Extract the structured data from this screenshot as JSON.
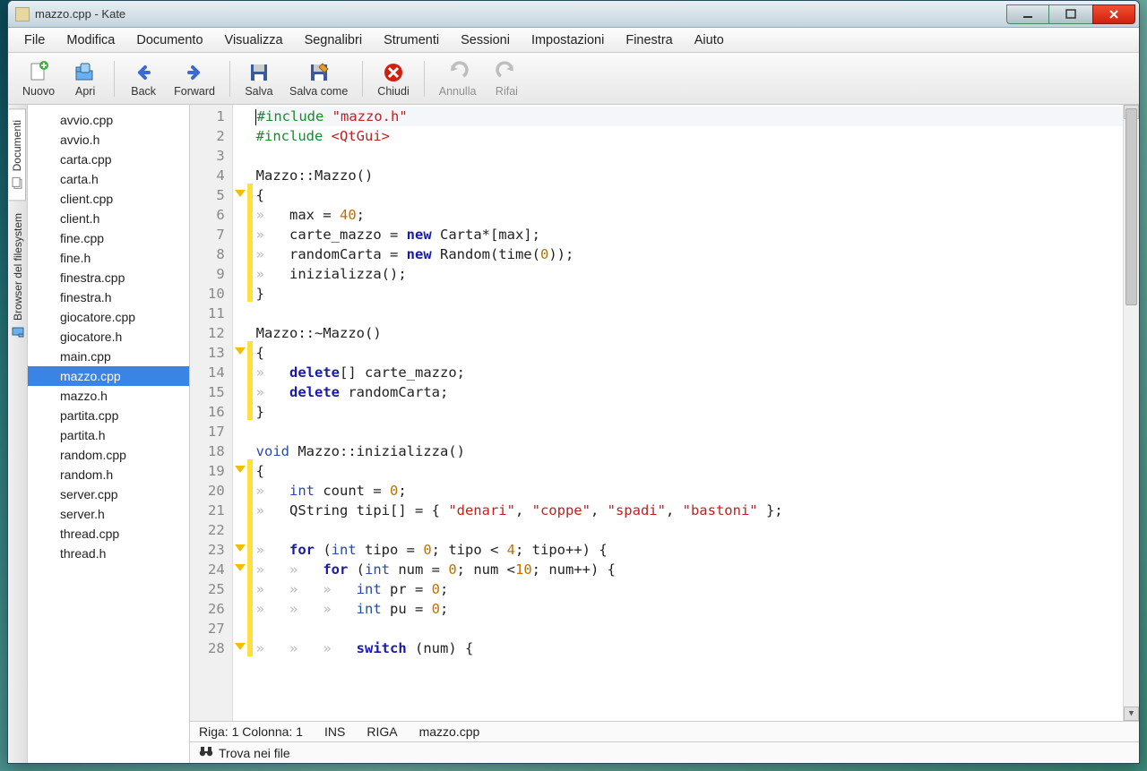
{
  "window": {
    "title": "mazzo.cpp - Kate"
  },
  "menu": [
    "File",
    "Modifica",
    "Documento",
    "Visualizza",
    "Segnalibri",
    "Strumenti",
    "Sessioni",
    "Impostazioni",
    "Finestra",
    "Aiuto"
  ],
  "toolbar": [
    {
      "icon": "new",
      "label": "Nuovo",
      "disabled": false
    },
    {
      "icon": "open",
      "label": "Apri",
      "disabled": false
    },
    {
      "sep": true
    },
    {
      "icon": "back",
      "label": "Back",
      "disabled": false
    },
    {
      "icon": "forward",
      "label": "Forward",
      "disabled": false
    },
    {
      "sep": true
    },
    {
      "icon": "save",
      "label": "Salva",
      "disabled": false
    },
    {
      "icon": "saveas",
      "label": "Salva come",
      "disabled": false
    },
    {
      "sep": true
    },
    {
      "icon": "close",
      "label": "Chiudi",
      "disabled": false
    },
    {
      "sep": true
    },
    {
      "icon": "undo",
      "label": "Annulla",
      "disabled": true
    },
    {
      "icon": "redo",
      "label": "Rifai",
      "disabled": true
    }
  ],
  "left_tabs": {
    "documents": "Documenti",
    "filesystem": "Browser del filesystem"
  },
  "files": [
    "avvio.cpp",
    "avvio.h",
    "carta.cpp",
    "carta.h",
    "client.cpp",
    "client.h",
    "fine.cpp",
    "fine.h",
    "finestra.cpp",
    "finestra.h",
    "giocatore.cpp",
    "giocatore.h",
    "main.cpp",
    "mazzo.cpp",
    "mazzo.h",
    "partita.cpp",
    "partita.h",
    "random.cpp",
    "random.h",
    "server.cpp",
    "server.h",
    "thread.cpp",
    "thread.h"
  ],
  "selected_file": "mazzo.cpp",
  "code_lines": [
    {
      "n": 1,
      "html": "<span class='pp'>#include</span> <span class='st'>\"mazzo.h\"</span>"
    },
    {
      "n": 2,
      "html": "<span class='pp'>#include</span> <span class='st'>&lt;QtGui&gt;</span>"
    },
    {
      "n": 3,
      "html": ""
    },
    {
      "n": 4,
      "html": "Mazzo::Mazzo()"
    },
    {
      "n": 5,
      "html": "{",
      "fold": true,
      "mod": true
    },
    {
      "n": 6,
      "html": "<span class='gy'>»   </span>max = <span class='nm'>40</span>;",
      "mod": true
    },
    {
      "n": 7,
      "html": "<span class='gy'>»   </span>carte_mazzo = <span class='kw'>new</span> Carta*[max];",
      "mod": true
    },
    {
      "n": 8,
      "html": "<span class='gy'>»   </span>randomCarta = <span class='kw'>new</span> Random(time(<span class='nm'>0</span>));",
      "mod": true
    },
    {
      "n": 9,
      "html": "<span class='gy'>»   </span>inizializza();",
      "mod": true
    },
    {
      "n": 10,
      "html": "}",
      "mod": true
    },
    {
      "n": 11,
      "html": ""
    },
    {
      "n": 12,
      "html": "Mazzo::~Mazzo()"
    },
    {
      "n": 13,
      "html": "{",
      "fold": true,
      "mod": true
    },
    {
      "n": 14,
      "html": "<span class='gy'>»   </span><span class='kw'>delete</span>[] carte_mazzo;",
      "mod": true
    },
    {
      "n": 15,
      "html": "<span class='gy'>»   </span><span class='kw'>delete</span> randomCarta;",
      "mod": true
    },
    {
      "n": 16,
      "html": "}",
      "mod": true
    },
    {
      "n": 17,
      "html": ""
    },
    {
      "n": 18,
      "html": "<span class='ty'>void</span> Mazzo::inizializza()"
    },
    {
      "n": 19,
      "html": "{",
      "fold": true,
      "mod": true
    },
    {
      "n": 20,
      "html": "<span class='gy'>»   </span><span class='ty'>int</span> count = <span class='nm'>0</span>;",
      "mod": true
    },
    {
      "n": 21,
      "html": "<span class='gy'>»   </span>QString tipi[] = { <span class='st'>\"denari\"</span>, <span class='st'>\"coppe\"</span>, <span class='st'>\"spadi\"</span>, <span class='st'>\"bastoni\"</span> };",
      "mod": true
    },
    {
      "n": 22,
      "html": "",
      "mod": true
    },
    {
      "n": 23,
      "html": "<span class='gy'>»   </span><span class='kw'>for</span> (<span class='ty'>int</span> tipo = <span class='nm'>0</span>; tipo &lt; <span class='nm'>4</span>; tipo++) {",
      "fold": true,
      "mod": true
    },
    {
      "n": 24,
      "html": "<span class='gy'>»   »   </span><span class='kw'>for</span> (<span class='ty'>int</span> num = <span class='nm'>0</span>; num &lt;<span class='nm'>10</span>; num++) {",
      "fold": true,
      "mod": true
    },
    {
      "n": 25,
      "html": "<span class='gy'>»   »   »   </span><span class='ty'>int</span> pr = <span class='nm'>0</span>;",
      "mod": true
    },
    {
      "n": 26,
      "html": "<span class='gy'>»   »   »   </span><span class='ty'>int</span> pu = <span class='nm'>0</span>;",
      "mod": true
    },
    {
      "n": 27,
      "html": "",
      "mod": true
    },
    {
      "n": 28,
      "html": "<span class='gy'>»   »   »   </span><span class='kw'>switch</span> (num) {",
      "fold": true,
      "mod": true
    }
  ],
  "status": {
    "riga_label": "Riga:",
    "riga": "1",
    "col_label": "Colonna:",
    "col": "1",
    "ins": "INS",
    "mode": "RIGA",
    "file": "mazzo.cpp"
  },
  "findbar": {
    "label": "Trova nei file"
  }
}
